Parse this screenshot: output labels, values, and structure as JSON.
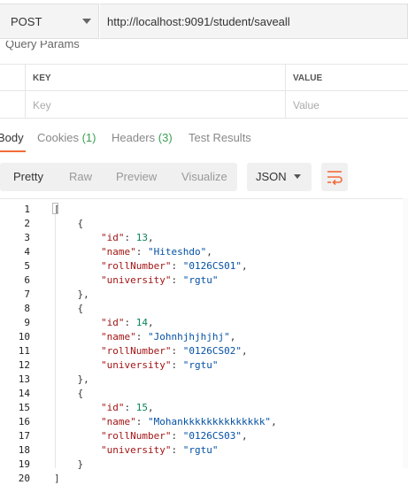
{
  "request": {
    "method": "POST",
    "url": "http://localhost:9091/student/saveall"
  },
  "query_params": {
    "title": "Query Params",
    "key_header": "KEY",
    "value_header": "VALUE",
    "key_placeholder": "Key",
    "value_placeholder": "Value"
  },
  "tabs": {
    "body": "Body",
    "cookies": "Cookies",
    "cookies_count": "(1)",
    "headers": "Headers",
    "headers_count": "(3)",
    "test_results": "Test Results"
  },
  "view_modes": [
    "Pretty",
    "Raw",
    "Preview",
    "Visualize"
  ],
  "format": "JSON",
  "icons": {
    "wrap": "wrap-lines-icon",
    "dropdown": "chevron-down-icon"
  },
  "colors": {
    "accent": "#f26b3a",
    "count": "#3a9e52",
    "json_key": "#a31515",
    "json_number": "#098658",
    "json_string": "#0451a5"
  },
  "records": [
    {
      "id": 13,
      "name": "Hiteshdo",
      "rollNumber": "0126CS01",
      "university": "rgtu"
    },
    {
      "id": 14,
      "name": "Johnhjhjhjhj",
      "rollNumber": "0126CS02",
      "university": "rgtu"
    },
    {
      "id": 15,
      "name": "Mohankkkkkkkkkkkkkk",
      "rollNumber": "0126CS03",
      "university": "rgtu"
    }
  ]
}
